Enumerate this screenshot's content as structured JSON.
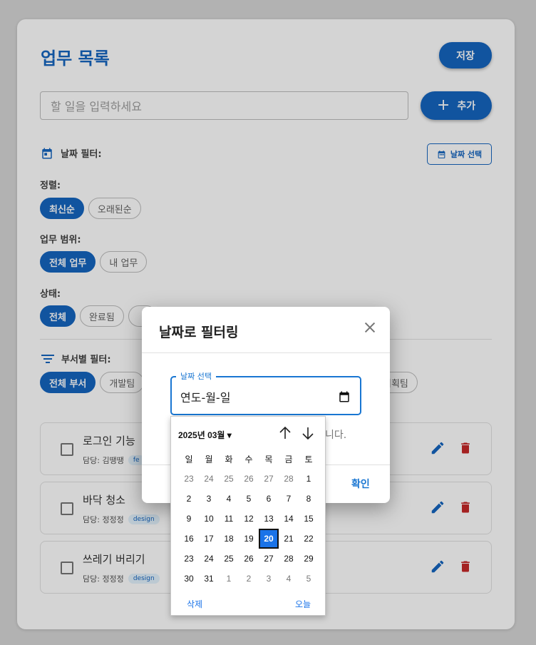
{
  "page": {
    "title": "업무 목록",
    "save_label": "저장",
    "task_input_placeholder": "할 일을 입력하세요",
    "add_label": "추가",
    "date_filter_label": "날짜 필터:",
    "date_select_button": "날짜 선택",
    "sort_label": "정렬:",
    "sort_options": [
      "최신순",
      "오래된순"
    ],
    "scope_label": "업무 범위:",
    "scope_options": [
      "전체 업무",
      "내 업무"
    ],
    "status_label": "상태:",
    "status_options": [
      "전체",
      "완료됨"
    ],
    "dept_label": "부서별 필터:",
    "dept_options": [
      "전체 부서",
      "개발팀"
    ],
    "dept_right_chip": "기획팀"
  },
  "tasks": [
    {
      "title": "로그인 기능",
      "assignee": "담당: 김땡땡",
      "tag": "fe"
    },
    {
      "title": "바닥 청소",
      "assignee": "담당: 정정정",
      "tag": "design"
    },
    {
      "title": "쓰레기 버리기",
      "assignee": "담당: 정정정",
      "tag": "design"
    }
  ],
  "dialog": {
    "title": "날짜로 필터링",
    "field_label": "날짜 선택",
    "field_value": "연도-월-일",
    "hint_fragment": "니다.",
    "confirm_label": "확인"
  },
  "calendar": {
    "month_label": "2025년 03월 ▾",
    "weekdays": [
      "일",
      "월",
      "화",
      "수",
      "목",
      "금",
      "토"
    ],
    "weeks": [
      [
        "23",
        "24",
        "25",
        "26",
        "27",
        "28",
        "1"
      ],
      [
        "2",
        "3",
        "4",
        "5",
        "6",
        "7",
        "8"
      ],
      [
        "9",
        "10",
        "11",
        "12",
        "13",
        "14",
        "15"
      ],
      [
        "16",
        "17",
        "18",
        "19",
        "20",
        "21",
        "22"
      ],
      [
        "23",
        "24",
        "25",
        "26",
        "27",
        "28",
        "29"
      ],
      [
        "30",
        "31",
        "1",
        "2",
        "3",
        "4",
        "5"
      ]
    ],
    "selected_day": "20",
    "clear_label": "삭제",
    "today_label": "오늘"
  },
  "colors": {
    "primary": "#1565c0",
    "delete_red": "#c62828",
    "selected_day": "#1a73e8"
  },
  "icons": [
    "calendar-icon",
    "filter-icon",
    "plus-icon",
    "edit-icon",
    "delete-icon",
    "close-icon",
    "arrow-up-icon",
    "arrow-down-icon"
  ]
}
